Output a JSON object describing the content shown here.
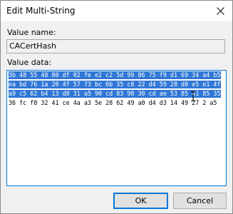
{
  "window": {
    "title": "Edit Multi-String"
  },
  "value_name": {
    "label": "Value name:",
    "value": "CACertHash"
  },
  "value_data": {
    "label": "Value data:",
    "selected_lines": [
      "3b 48 55 48 80 df 02 fe e2 c2 5d 99 86 75 f9 d1 69 34 a4 b5",
      "ea bd 76 1a 20 4f 57 73 bc 6b 35 c8 22 d4 59 28 d0 e5 e1 4f",
      "a9 c5 62 b4 13 d8 31 a5 90 cd 83 98 30 cd ae 53 85 41 85 35"
    ],
    "unselected_lines": [
      "36 fc f8 32 41 ce 4a a3 5e 28 62 49 a0 d4 d3 14 49 27 2 a5"
    ]
  },
  "buttons": {
    "ok": "OK",
    "cancel": "Cancel"
  },
  "colors": {
    "accent": "#0078d7",
    "selection": "#3077d6"
  }
}
